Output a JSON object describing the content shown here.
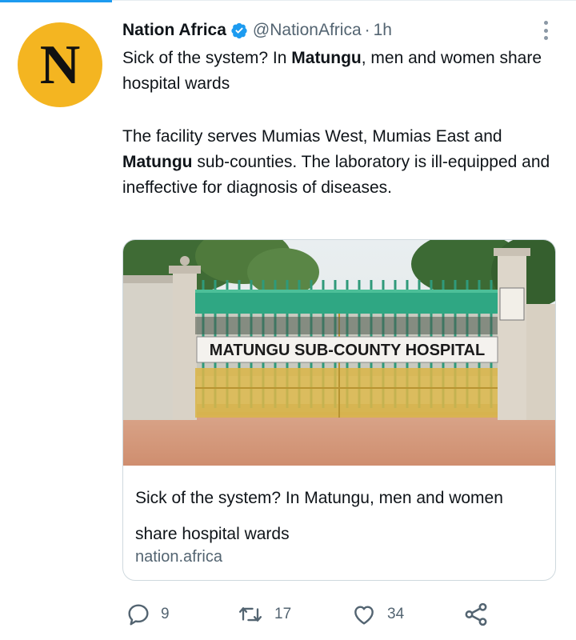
{
  "tweet": {
    "author_name": "Nation Africa",
    "avatar_letter": "N",
    "handle": "@NationAfrica",
    "separator": "·",
    "time": "1h",
    "body": {
      "p1_a": "Sick of the system? In ",
      "p1_b": "Matungu",
      "p1_c": ", men and women share hospital wards",
      "p2_a": "The facility serves Mumias West, Mumias East and ",
      "p2_b": "Matungu",
      "p2_c": " sub-counties. The laboratory is ill-equipped and ineffective for diagnosis of diseases."
    }
  },
  "card": {
    "sign_text": "MATUNGU SUB-COUNTY HOSPITAL",
    "title": "Sick of the system? In Matungu, men and women share hospital wards",
    "domain": "nation.africa"
  },
  "actions": {
    "replies": "9",
    "retweets": "17",
    "likes": "34"
  },
  "colors": {
    "accent": "#1d9bf0",
    "avatar_bg": "#f4b521",
    "secondary_text": "#536471"
  }
}
